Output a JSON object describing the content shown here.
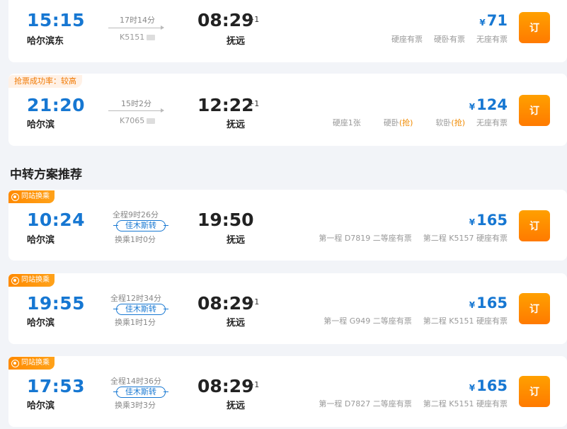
{
  "direct": [
    {
      "dep_time": "15:15",
      "dep_station": "哈尔滨东",
      "duration": "17时14分",
      "train": "K5151",
      "arr_time": "08:29",
      "arr_plus": "+1",
      "arr_station": "抚远",
      "price": "71",
      "currency": "¥",
      "seats": [
        {
          "text": "硬座有票"
        },
        {
          "text": "硬卧有票"
        },
        {
          "text": "无座有票"
        }
      ],
      "book_label": "订"
    },
    {
      "tag": "抢票成功率：较高",
      "dep_time": "21:20",
      "dep_station": "哈尔滨",
      "duration": "15时2分",
      "train": "K7065",
      "arr_time": "12:22",
      "arr_plus": "+1",
      "arr_station": "抚远",
      "price": "124",
      "currency": "¥",
      "seats": [
        {
          "text": "硬座1张"
        },
        {
          "text": "硬卧",
          "grab": "(抢)"
        },
        {
          "text": "软卧",
          "grab": "(抢)"
        },
        {
          "text": "无座有票"
        }
      ],
      "book_label": "订"
    }
  ],
  "section_title": "中转方案推荐",
  "transfers": [
    {
      "tag": "同站换乘",
      "dep_time": "10:24",
      "dep_station": "哈尔滨",
      "total": "全程9时26分",
      "via": "佳木斯转",
      "wait": "换乘1时0分",
      "arr_time": "19:50",
      "arr_plus": "",
      "arr_station": "抚远",
      "price": "165",
      "currency": "¥",
      "leg1": "第一程 D7819 二等座有票",
      "leg2": "第二程 K5157 硬座有票",
      "book_label": "订"
    },
    {
      "tag": "同站换乘",
      "dep_time": "19:55",
      "dep_station": "哈尔滨",
      "total": "全程12时34分",
      "via": "佳木斯转",
      "wait": "换乘1时1分",
      "arr_time": "08:29",
      "arr_plus": "+1",
      "arr_station": "抚远",
      "price": "165",
      "currency": "¥",
      "leg1": "第一程 G949 二等座有票",
      "leg2": "第二程 K5151 硬座有票",
      "book_label": "订"
    },
    {
      "tag": "同站换乘",
      "dep_time": "17:53",
      "dep_station": "哈尔滨",
      "total": "全程14时36分",
      "via": "佳木斯转",
      "wait": "换乘3时3分",
      "arr_time": "08:29",
      "arr_plus": "+1",
      "arr_station": "抚远",
      "price": "165",
      "currency": "¥",
      "leg1": "第一程 D7827 二等座有票",
      "leg2": "第二程 K5151 硬座有票",
      "book_label": "订"
    }
  ]
}
